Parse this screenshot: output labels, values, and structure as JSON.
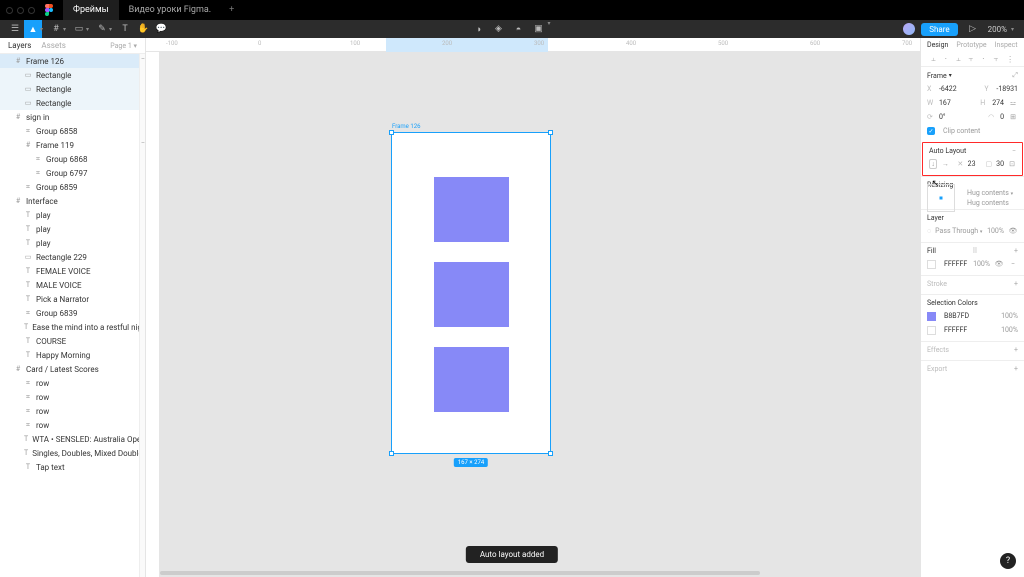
{
  "tabs": {
    "file1": "Фреймы",
    "file2": "Видео уроки Figma."
  },
  "toolbar": {
    "zoom": "200%"
  },
  "share_label": "Share",
  "left": {
    "tab_layers": "Layers",
    "tab_assets": "Assets",
    "page": "Page 1",
    "items": [
      {
        "label": "Frame 126",
        "depth": 1,
        "sel": true,
        "icon": "#"
      },
      {
        "label": "Rectangle",
        "depth": 2,
        "range": true,
        "icon": "▭"
      },
      {
        "label": "Rectangle",
        "depth": 2,
        "range": true,
        "icon": "▭"
      },
      {
        "label": "Rectangle",
        "depth": 2,
        "range": true,
        "icon": "▭"
      },
      {
        "label": "sign in",
        "depth": 1,
        "icon": "#"
      },
      {
        "label": "Group 6858",
        "depth": 2,
        "icon": "⌗"
      },
      {
        "label": "Frame 119",
        "depth": 2,
        "icon": "#"
      },
      {
        "label": "Group 6868",
        "depth": 3,
        "icon": "⌗"
      },
      {
        "label": "Group 6797",
        "depth": 3,
        "icon": "⌗"
      },
      {
        "label": "Group 6859",
        "depth": 2,
        "icon": "⌗"
      },
      {
        "label": "Interface",
        "depth": 1,
        "icon": "#"
      },
      {
        "label": "play",
        "depth": 2,
        "icon": "T"
      },
      {
        "label": "play",
        "depth": 2,
        "icon": "T"
      },
      {
        "label": "play",
        "depth": 2,
        "icon": "T"
      },
      {
        "label": "Rectangle 229",
        "depth": 2,
        "icon": "▭"
      },
      {
        "label": "FEMALE VOICE",
        "depth": 2,
        "icon": "T"
      },
      {
        "label": "MALE VOICE",
        "depth": 2,
        "icon": "T"
      },
      {
        "label": "Pick a Narrator",
        "depth": 2,
        "icon": "T"
      },
      {
        "label": "Group 6839",
        "depth": 2,
        "icon": "⌗"
      },
      {
        "label": "Ease the mind into a restful night's sleep with t...",
        "depth": 2,
        "icon": "T"
      },
      {
        "label": "COURSE",
        "depth": 2,
        "icon": "T"
      },
      {
        "label": "Happy Morning",
        "depth": 2,
        "icon": "T"
      },
      {
        "label": "Card / Latest Scores",
        "depth": 1,
        "icon": "#"
      },
      {
        "label": "row",
        "depth": 2,
        "icon": "⌗"
      },
      {
        "label": "row",
        "depth": 2,
        "icon": "⌗"
      },
      {
        "label": "row",
        "depth": 2,
        "icon": "⌗"
      },
      {
        "label": "row",
        "depth": 2,
        "icon": "⌗"
      },
      {
        "label": "WTA • SENSLED: Australia Open, hard",
        "depth": 2,
        "icon": "T"
      },
      {
        "label": "Singles, Doubles, Mixed Doubles",
        "depth": 2,
        "icon": "T"
      },
      {
        "label": "Tap text",
        "depth": 2,
        "icon": "T"
      }
    ]
  },
  "ruler": {
    "marks": [
      "-100",
      "0",
      "100",
      "200",
      "300",
      "400",
      "500",
      "600",
      "700"
    ]
  },
  "canvas": {
    "frame_label": "Frame 126",
    "dim_badge": "167 × 274"
  },
  "right": {
    "tab_design": "Design",
    "tab_prototype": "Prototype",
    "tab_inspect": "Inspect",
    "frame": {
      "title": "Frame",
      "x_lbl": "X",
      "x": "-6422",
      "y_lbl": "Y",
      "y": "-18931",
      "w_lbl": "W",
      "w": "167",
      "h_lbl": "H",
      "h": "274",
      "rot_lbl": "⟳",
      "rot": "0°",
      "rad_lbl": "◠",
      "rad": "0",
      "clip": "Clip content"
    },
    "autolayout": {
      "title": "Auto Layout",
      "gap": "23",
      "pad": "30"
    },
    "resizing": {
      "title": "Resizing",
      "h": "Hug contents",
      "v": "Hug contents"
    },
    "layer": {
      "title": "Layer",
      "mode": "Pass Through",
      "opacity": "100%"
    },
    "fill": {
      "title": "Fill",
      "hex": "FFFFFF",
      "opacity": "100%"
    },
    "stroke": {
      "title": "Stroke"
    },
    "selcolors": {
      "title": "Selection Colors",
      "c1": "B8B7FD",
      "o1": "100%",
      "c2": "FFFFFF",
      "o2": "100%"
    },
    "effects": {
      "title": "Effects"
    },
    "export": {
      "title": "Export"
    }
  },
  "toast": "Auto layout added",
  "help": "?"
}
